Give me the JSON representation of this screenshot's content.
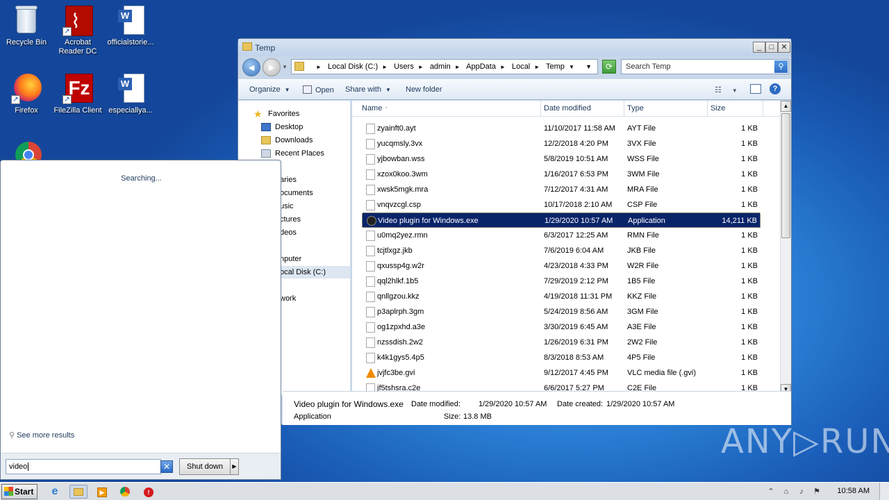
{
  "desktop_icons": [
    {
      "label": "Recycle Bin",
      "icon": "recycle-bin-icon"
    },
    {
      "label": "Acrobat\nReader DC",
      "icon": "acrobat-icon"
    },
    {
      "label": "officialstorie...",
      "icon": "word-document-icon"
    },
    {
      "label": "Firefox",
      "icon": "firefox-icon"
    },
    {
      "label": "FileZilla Client",
      "icon": "filezilla-icon"
    },
    {
      "label": "especiallya...",
      "icon": "word-document-icon"
    },
    {
      "label": "",
      "icon": "chrome-icon"
    }
  ],
  "explorer": {
    "title": "Temp",
    "window_buttons": {
      "minimize": "_",
      "maximize": "□",
      "close": "✕"
    },
    "breadcrumb": [
      "Local Disk (C:)",
      "Users",
      "admin",
      "AppData",
      "Local",
      "Temp"
    ],
    "search_placeholder": "Search Temp",
    "toolbar": {
      "organize": "Organize",
      "open": "Open",
      "share_with": "Share with",
      "new_folder": "New folder"
    },
    "nav_pane": {
      "favorites": "Favorites",
      "favorite_items": [
        "Desktop",
        "Downloads",
        "Recent Places"
      ],
      "libraries_partial": "aries",
      "library_items_partial": [
        "ocuments",
        "usic",
        "ctures",
        "deos"
      ],
      "computer_partial": "nputer",
      "local_disk_partial": "ocal Disk (C:)",
      "network_partial": "work"
    },
    "columns": {
      "name": "Name",
      "date": "Date modified",
      "type": "Type",
      "size": "Size"
    },
    "files": [
      {
        "name": "zyainft0.ayt",
        "date": "11/10/2017 11:58 AM",
        "type": "AYT File",
        "size": "1 KB"
      },
      {
        "name": "yucqmsly.3vx",
        "date": "12/2/2018 4:20 PM",
        "type": "3VX File",
        "size": "1 KB"
      },
      {
        "name": "yjbowban.wss",
        "date": "5/8/2019 10:51 AM",
        "type": "WSS File",
        "size": "1 KB"
      },
      {
        "name": "xzox0koo.3wm",
        "date": "1/16/2017 6:53 PM",
        "type": "3WM File",
        "size": "1 KB"
      },
      {
        "name": "xwsk5mgk.mra",
        "date": "7/12/2017 4:31 AM",
        "type": "MRA File",
        "size": "1 KB"
      },
      {
        "name": "vnqvzcgl.csp",
        "date": "10/17/2018 2:10 AM",
        "type": "CSP File",
        "size": "1 KB"
      },
      {
        "name": "Video plugin for Windows.exe",
        "date": "1/29/2020 10:57 AM",
        "type": "Application",
        "size": "14,211 KB",
        "selected": true
      },
      {
        "name": "u0mq2yez.rmn",
        "date": "6/3/2017 12:25 AM",
        "type": "RMN File",
        "size": "1 KB"
      },
      {
        "name": "tcjtlxgz.jkb",
        "date": "7/6/2019 6:04 AM",
        "type": "JKB File",
        "size": "1 KB"
      },
      {
        "name": "qxussp4g.w2r",
        "date": "4/23/2018 4:33 PM",
        "type": "W2R File",
        "size": "1 KB"
      },
      {
        "name": "qql2hlkf.1b5",
        "date": "7/29/2019 2:12 PM",
        "type": "1B5 File",
        "size": "1 KB"
      },
      {
        "name": "qnllgzou.kkz",
        "date": "4/19/2018 11:31 PM",
        "type": "KKZ File",
        "size": "1 KB"
      },
      {
        "name": "p3aplrph.3gm",
        "date": "5/24/2019 8:56 AM",
        "type": "3GM File",
        "size": "1 KB"
      },
      {
        "name": "og1zpxhd.a3e",
        "date": "3/30/2019 6:45 AM",
        "type": "A3E File",
        "size": "1 KB"
      },
      {
        "name": "nzssdish.2w2",
        "date": "1/26/2019 6:31 PM",
        "type": "2W2 File",
        "size": "1 KB"
      },
      {
        "name": "k4k1gys5.4p5",
        "date": "8/3/2018 8:53 AM",
        "type": "4P5 File",
        "size": "1 KB"
      },
      {
        "name": "jvjfc3be.gvi",
        "date": "9/12/2017 4:45 PM",
        "type": "VLC media file (.gvi)",
        "size": "1 KB",
        "icon": "vlc-icon"
      },
      {
        "name": "jf5tshsra.c2e",
        "date": "6/6/2017 5:27 PM",
        "type": "C2E File",
        "size": "1 KB"
      }
    ],
    "details": {
      "filename": "Video plugin for Windows.exe",
      "date_modified_label": "Date modified:",
      "date_modified": "1/29/2020 10:57 AM",
      "date_created_label": "Date created:",
      "date_created": "1/29/2020 10:57 AM",
      "type": "Application",
      "size_label": "Size:",
      "size": "13.8 MB"
    }
  },
  "start_menu": {
    "status": "Searching...",
    "see_more": "See more results",
    "search_value": "video",
    "shutdown_label": "Shut down",
    "clear_glyph": "✕"
  },
  "taskbar": {
    "start_label": "Start",
    "pinned": [
      "internet-explorer-icon",
      "explorer-icon",
      "media-player-icon",
      "chrome-icon",
      "opera-icon"
    ],
    "clock": "10:58 AM"
  },
  "watermark": "ANY▷RUN",
  "colors": {
    "selection": "#0a246a",
    "desktop": "#2b80d6",
    "accent": "#1e395b"
  }
}
